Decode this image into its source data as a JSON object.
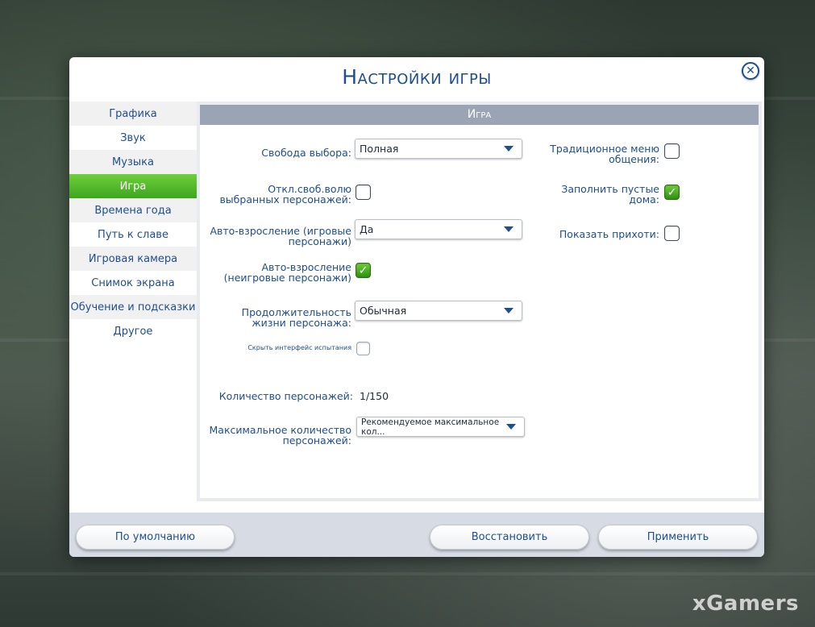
{
  "dialog": {
    "title": "Настройки игры",
    "close_glyph": "✕"
  },
  "sidebar": {
    "items": [
      {
        "label": "Графика",
        "active": false
      },
      {
        "label": "Звук",
        "active": false
      },
      {
        "label": "Музыка",
        "active": false
      },
      {
        "label": "Игра",
        "active": true
      },
      {
        "label": "Времена года",
        "active": false
      },
      {
        "label": "Путь к славе",
        "active": false
      },
      {
        "label": "Игровая камера",
        "active": false
      },
      {
        "label": "Снимок экрана",
        "active": false
      },
      {
        "label": "Обучение и подсказки",
        "active": false
      },
      {
        "label": "Другое",
        "active": false
      }
    ]
  },
  "panel": {
    "header": "Игра",
    "free_will_label": "Свобода выбора:",
    "free_will_value": "Полная",
    "disable_free_will_label": "Откл.своб.волю выбранных персонажей:",
    "disable_free_will_checked": false,
    "auto_aging_played_label": "Авто-взросление (игровые персонажи)",
    "auto_aging_played_value": "Да",
    "auto_aging_unplayed_label": "Авто-взросление (неигровые персонажи)",
    "auto_aging_unplayed_checked": true,
    "lifespan_label": "Продолжительность жизни персонажа:",
    "lifespan_value": "Обычная",
    "hide_challenge_ui_label": "Скрыть интерфейс испытания",
    "hide_challenge_ui_checked": false,
    "sim_count_label": "Количество персонажей:",
    "sim_count_value": "1/150",
    "max_sims_label": "Максимальное количество персонажей:",
    "max_sims_value": "Рекомендуемое максимальное кол...",
    "traditional_menu_label": "Традиционное меню общения:",
    "traditional_menu_checked": false,
    "fill_empty_lots_label": "Заполнить пустые дома:",
    "fill_empty_lots_checked": true,
    "show_whims_label": "Показать прихоти:",
    "show_whims_checked": false,
    "check_glyph": "✓"
  },
  "footer": {
    "default_label": "По умолчанию",
    "restore_label": "Восстановить",
    "apply_label": "Применить"
  },
  "watermark": "xGamers",
  "colors": {
    "accent_blue": "#1f4e8f",
    "active_green": "#3ea51f",
    "header_gray": "#9aa4b4"
  }
}
